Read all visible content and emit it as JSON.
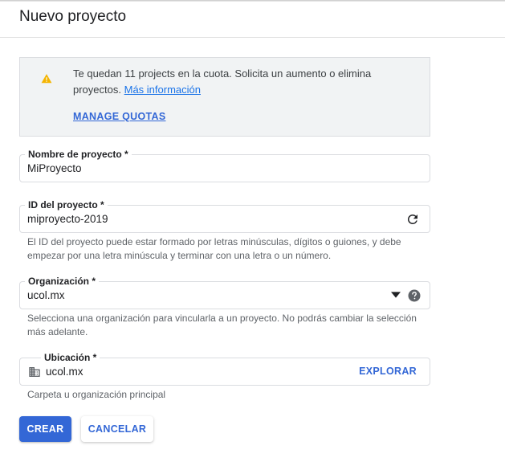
{
  "header": {
    "title": "Nuevo proyecto"
  },
  "notice": {
    "icon": "warning-icon",
    "icon_color": "#f4b400",
    "message": "Te quedan 11 projects en la cuota. Solicita un aumento o elimina proyectos.",
    "more_link": "Más información",
    "manage_link": "MANAGE QUOTAS"
  },
  "fields": {
    "project_name": {
      "label": "Nombre de proyecto *",
      "value": "MiProyecto"
    },
    "project_id": {
      "label": "ID del proyecto *",
      "value": "miproyecto-2019",
      "icon": "refresh-icon",
      "helper": "El ID del proyecto puede estar formado por letras minúsculas, dígitos o guiones, y debe empezar por una letra minúscula y terminar con una letra o un número."
    },
    "organization": {
      "label": "Organización *",
      "value": "ucol.mx",
      "icons": [
        "dropdown-icon",
        "help-icon"
      ],
      "helper": "Selecciona una organización para vincularla a un proyecto. No podrás cambiar la selección más adelante."
    },
    "location": {
      "label": "Ubicación *",
      "value": "ucol.mx",
      "icon": "building-icon",
      "action": "EXPLORAR",
      "helper": "Carpeta u organización principal"
    }
  },
  "actions": {
    "create": "CREAR",
    "cancel": "CANCELAR"
  },
  "colors": {
    "accent": "#3367d6",
    "link": "#1a73e8",
    "notice_bg": "#f1f3f4"
  }
}
